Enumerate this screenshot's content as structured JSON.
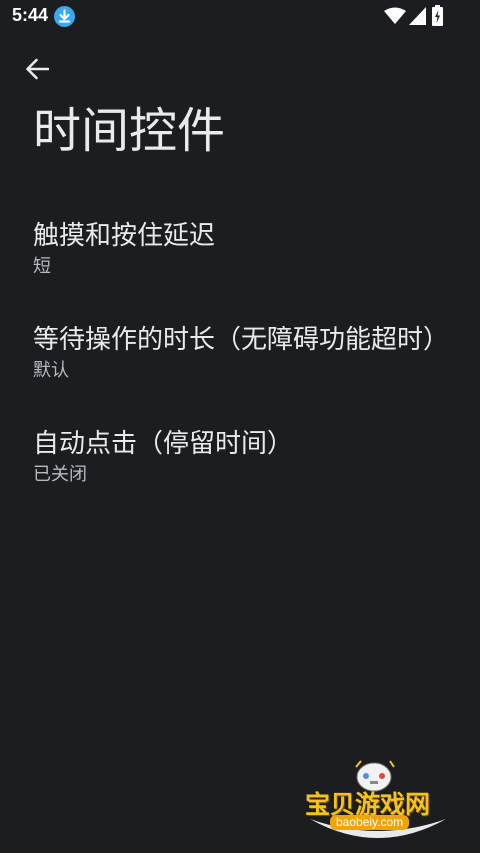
{
  "status_bar": {
    "time": "5:44",
    "icons": [
      "download-icon",
      "wifi-icon",
      "cell-signal-icon",
      "battery-charging-icon"
    ]
  },
  "header": {
    "back_icon": "arrow-left-icon",
    "title": "时间控件"
  },
  "settings": [
    {
      "title": "触摸和按住延迟",
      "summary": "短"
    },
    {
      "title": "等待操作的时长（无障碍功能超时）",
      "summary": "默认"
    },
    {
      "title": "自动点击（停留时间）",
      "summary": "已关闭"
    }
  ],
  "watermark": {
    "title": "宝贝游戏网",
    "url": "baobeiy.com"
  },
  "colors": {
    "background": "#1b1d20",
    "primary_text": "#e8eaed",
    "secondary_text": "#b7bbc0",
    "download_badge": "#3aa8f0",
    "watermark_gold": "#f6c21c"
  }
}
